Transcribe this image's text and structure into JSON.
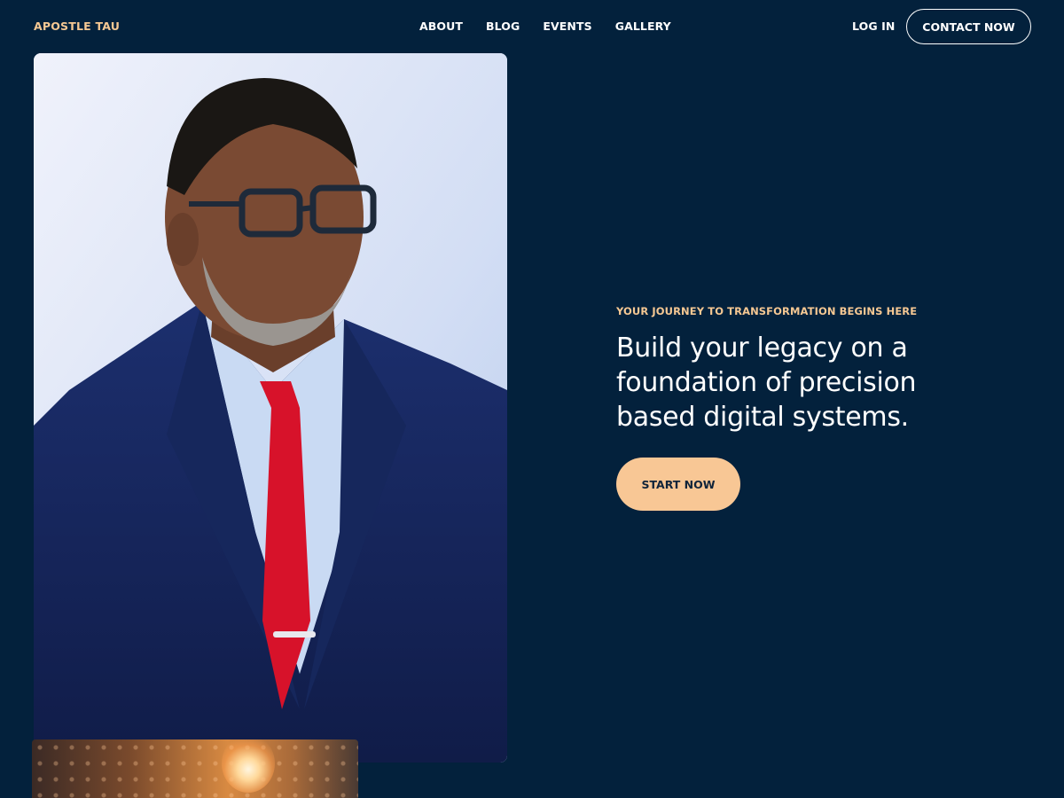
{
  "header": {
    "brand": "APOSTLE TAU",
    "nav": [
      {
        "label": "ABOUT"
      },
      {
        "label": "BLOG"
      },
      {
        "label": "EVENTS"
      },
      {
        "label": "GALLERY"
      }
    ],
    "login_label": "LOG IN",
    "contact_label": "CONTACT NOW"
  },
  "hero": {
    "eyebrow": "YOUR JOURNEY TO TRANSFORMATION BEGINS HERE",
    "headline_line1": "Build your legacy on a",
    "headline_line2": "foundation of precision",
    "headline_line3": "based digital systems.",
    "cta_label": "START NOW"
  },
  "colors": {
    "background": "#03213c",
    "accent": "#f6c893",
    "cta_background": "#f8c795"
  }
}
